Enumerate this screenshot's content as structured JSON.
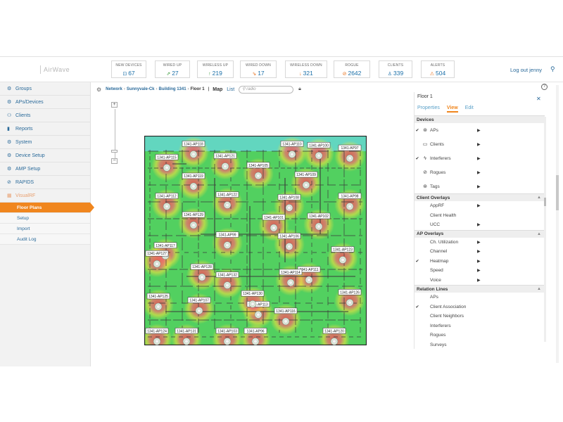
{
  "header": {
    "logo": "AirWave",
    "stats": [
      {
        "label": "NEW DEVICES",
        "value": "67",
        "icon": "device-icon",
        "glyph": "⊡",
        "color": "#1a6fa8"
      },
      {
        "label": "WIRED UP",
        "value": "27",
        "icon": "wired-up-icon",
        "glyph": "⇗",
        "color": "#3a9a3a"
      },
      {
        "label": "WIRELESS UP",
        "value": "219",
        "icon": "wireless-up-icon",
        "glyph": "↑",
        "color": "#3a9a3a"
      },
      {
        "label": "WIRED DOWN",
        "value": "17",
        "icon": "wired-down-icon",
        "glyph": "⇘",
        "color": "#e8721e"
      },
      {
        "label": "WIRELESS DOWN",
        "value": "321",
        "icon": "wireless-down-icon",
        "glyph": "↓",
        "color": "#e8721e"
      },
      {
        "label": "ROGUE",
        "value": "2642",
        "icon": "rogue-icon",
        "glyph": "⊘",
        "color": "#e8721e"
      },
      {
        "label": "CLIENTS",
        "value": "339",
        "icon": "clients-icon",
        "glyph": "♙",
        "color": "#1a6fa8"
      },
      {
        "label": "ALERTS",
        "value": "504",
        "icon": "alert-icon",
        "glyph": "⚠",
        "color": "#e8721e"
      }
    ],
    "logout": "Log out jenny"
  },
  "sidebar": {
    "items": [
      {
        "label": "Groups",
        "icon": "groups-icon",
        "glyph": "⚙"
      },
      {
        "label": "APs/Devices",
        "icon": "devices-icon",
        "glyph": "⚙"
      },
      {
        "label": "Clients",
        "icon": "clients-icon",
        "glyph": "⚇"
      },
      {
        "label": "Reports",
        "icon": "reports-icon",
        "glyph": "▮"
      },
      {
        "label": "System",
        "icon": "system-icon",
        "glyph": "⚙"
      },
      {
        "label": "Device Setup",
        "icon": "device-setup-icon",
        "glyph": "⚙"
      },
      {
        "label": "AMP Setup",
        "icon": "amp-setup-icon",
        "glyph": "⚙"
      },
      {
        "label": "RAPIDS",
        "icon": "rapids-icon",
        "glyph": "⊘"
      },
      {
        "label": "VisualRF",
        "icon": "visualrf-icon",
        "glyph": "▦"
      }
    ],
    "subitems": [
      "Floor Plans",
      "Setup",
      "Import",
      "Audit Log"
    ]
  },
  "toolbar": {
    "crumbs": [
      "Network",
      "Sunnyvale-Ck",
      "Building 1341"
    ],
    "current": "Floor 1",
    "tab_map": "Map",
    "tab_list": "List",
    "search_placeholder": "radio"
  },
  "panel": {
    "title": "Floor 1",
    "tabs": [
      "Properties",
      "View",
      "Edit"
    ],
    "sections": [
      {
        "title": "Devices",
        "rows": [
          {
            "label": "APs",
            "checked": true,
            "icon": "ap-icon",
            "glyph": "⊛",
            "arrow": true
          },
          {
            "label": "Clients",
            "checked": false,
            "icon": "monitor-icon",
            "glyph": "▭",
            "arrow": true
          },
          {
            "label": "Interferers",
            "checked": true,
            "icon": "interferer-icon",
            "glyph": "ϟ",
            "arrow": true
          },
          {
            "label": "Rogues",
            "checked": false,
            "icon": "rogue-icon",
            "glyph": "⊘",
            "arrow": true
          },
          {
            "label": "Tags",
            "checked": false,
            "icon": "tag-icon",
            "glyph": "⊛",
            "arrow": true
          }
        ]
      },
      {
        "title": "Client Overlays",
        "rows": [
          {
            "label": "AppRF",
            "checked": false,
            "arrow": true
          },
          {
            "label": "Client Health",
            "checked": false,
            "arrow": false
          },
          {
            "label": "UCC",
            "checked": false,
            "arrow": true
          }
        ]
      },
      {
        "title": "AP Overlays",
        "rows": [
          {
            "label": "Ch. Utilization",
            "checked": false,
            "arrow": true
          },
          {
            "label": "Channel",
            "checked": false,
            "arrow": true
          },
          {
            "label": "Heatmap",
            "checked": true,
            "arrow": true
          },
          {
            "label": "Speed",
            "checked": false,
            "arrow": true
          },
          {
            "label": "Voice",
            "checked": false,
            "arrow": true
          }
        ]
      },
      {
        "title": "Relation Lines",
        "rows": [
          {
            "label": "APs",
            "checked": false,
            "arrow": false
          },
          {
            "label": "Client Association",
            "checked": true,
            "arrow": false
          },
          {
            "label": "Client Neighbors",
            "checked": false,
            "arrow": false
          },
          {
            "label": "Interferers",
            "checked": false,
            "arrow": false
          },
          {
            "label": "Rogues",
            "checked": false,
            "arrow": false
          },
          {
            "label": "Surveys",
            "checked": false,
            "arrow": false
          }
        ]
      }
    ]
  },
  "floorplan": {
    "aps": [
      {
        "label": "1341-AP118"
      },
      {
        "label": "1341-AP115"
      },
      {
        "label": "1341-AP121"
      },
      {
        "label": "1341-AP105"
      },
      {
        "label": "1341-AP110"
      },
      {
        "label": "1341-AP100"
      },
      {
        "label": "1341-AP97"
      },
      {
        "label": "1341-AP119"
      },
      {
        "label": "1341-AP109"
      },
      {
        "label": "1341-AP112"
      },
      {
        "label": "1341-AP122"
      },
      {
        "label": "1341-AP108"
      },
      {
        "label": "1341-AP98"
      },
      {
        "label": "1341-AP129"
      },
      {
        "label": "1341-AP101"
      },
      {
        "label": "1341-AP102"
      },
      {
        "label": "1341-AP117"
      },
      {
        "label": "1341-AP128"
      },
      {
        "label": "1341-AP106"
      },
      {
        "label": "1341-AP99"
      },
      {
        "label": "1341-AP123"
      },
      {
        "label": "1341-AP111"
      },
      {
        "label": "1341-AP132"
      },
      {
        "label": "1341-AP114"
      },
      {
        "label": "1341-AP113"
      },
      {
        "label": "1341-AP125"
      },
      {
        "label": "1341-AP107"
      },
      {
        "label": "1341-AP126"
      },
      {
        "label": "1341-AP130"
      },
      {
        "label": "1341-AP116"
      },
      {
        "label": "1341-AP124"
      },
      {
        "label": "1341-AP131"
      },
      {
        "label": "1341-AP120"
      },
      {
        "label": "1341-AP96"
      },
      {
        "label": "1341-AP103"
      },
      {
        "label": "1341-AP127"
      }
    ]
  }
}
